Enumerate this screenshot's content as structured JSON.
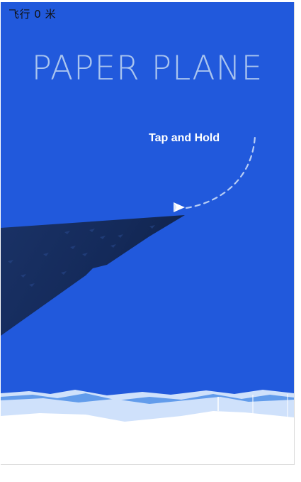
{
  "hud": {
    "distance_text": "飞行 0 米"
  },
  "title": "PAPER PLANE",
  "hint": "Tap and Hold",
  "colors": {
    "sky": "#2159dc",
    "title": "#a9c4ef",
    "cliff_dark": "#13254d",
    "hint": "#ffffff",
    "ground_light": "#cfe1fb",
    "ground_mid": "#4f8fe8",
    "snow": "#ffffff"
  },
  "icons": {
    "plane": "paper-plane-icon",
    "trajectory": "dashed-arc"
  }
}
